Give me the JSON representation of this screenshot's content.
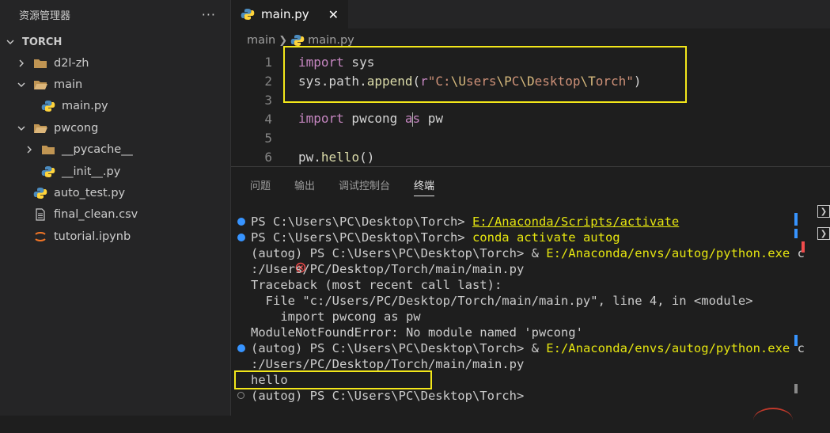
{
  "explorer": {
    "title": "资源管理器",
    "more": "···",
    "section": "TORCH",
    "items": [
      {
        "label": "d2l-zh",
        "type": "folder",
        "expanded": false,
        "depth": 1
      },
      {
        "label": "main",
        "type": "folder",
        "expanded": true,
        "depth": 1
      },
      {
        "label": "main.py",
        "type": "python",
        "depth": 2
      },
      {
        "label": "pwcong",
        "type": "folder",
        "expanded": true,
        "depth": 1
      },
      {
        "label": "__pycache__",
        "type": "folder",
        "expanded": false,
        "depth": 2
      },
      {
        "label": "__init__.py",
        "type": "python",
        "depth": 2
      },
      {
        "label": "auto_test.py",
        "type": "python",
        "depth": 1
      },
      {
        "label": "final_clean.csv",
        "type": "csv",
        "depth": 1
      },
      {
        "label": "tutorial.ipynb",
        "type": "notebook",
        "depth": 1
      }
    ]
  },
  "editor": {
    "tab_label": "main.py",
    "tab_close": "✕",
    "breadcrumb": [
      "main",
      "main.py"
    ],
    "lines": [
      {
        "n": "1",
        "text": "import sys"
      },
      {
        "n": "2",
        "text": "sys.path.append(r\"C:\\Users\\PC\\Desktop\\Torch\")"
      },
      {
        "n": "3",
        "text": ""
      },
      {
        "n": "4",
        "text": "import pwcong as pw"
      },
      {
        "n": "5",
        "text": ""
      },
      {
        "n": "6",
        "text": "pw.hello()"
      }
    ]
  },
  "panel": {
    "tabs": [
      "问题",
      "输出",
      "调试控制台",
      "终端"
    ],
    "active_tab": "终端"
  },
  "terminal": {
    "lines": [
      {
        "status": "blue",
        "prefix": "PS C:\\Users\\PC\\Desktop\\Torch> ",
        "cmd": "E:/Anaconda/Scripts/activate",
        "cmd_style": "underline"
      },
      {
        "status": "blue",
        "prefix": "PS C:\\Users\\PC\\Desktop\\Torch> ",
        "cmd": "conda activate autog",
        "cmd_style": "yellow"
      },
      {
        "status": "error",
        "prefix": "(autog) PS C:\\Users\\PC\\Desktop\\Torch> & ",
        "cmd": "E:/Anaconda/envs/autog/python.exe",
        "suffix": " c",
        "cmd_style": "yellow"
      },
      {
        "status": "",
        "prefix": ":/Users/PC/Desktop/Torch/main/main.py"
      },
      {
        "status": "",
        "prefix": "Traceback (most recent call last):"
      },
      {
        "status": "",
        "prefix": "  File \"c:/Users/PC/Desktop/Torch/main/main.py\", line 4, in <module>"
      },
      {
        "status": "",
        "prefix": "    import pwcong as pw"
      },
      {
        "status": "",
        "prefix": "ModuleNotFoundError: No module named 'pwcong'"
      },
      {
        "status": "blue",
        "prefix": "(autog) PS C:\\Users\\PC\\Desktop\\Torch> & ",
        "cmd": "E:/Anaconda/envs/autog/python.exe",
        "suffix": " c",
        "cmd_style": "yellow"
      },
      {
        "status": "",
        "prefix": ":/Users/PC/Desktop/Torch/main/main.py"
      },
      {
        "status": "",
        "prefix": "hello"
      },
      {
        "status": "hollow",
        "prefix": "(autog) PS C:\\Users\\PC\\Desktop\\Torch>"
      }
    ]
  },
  "colors": {
    "highlight_box": "#f3e71a",
    "keyword": "#c586c0",
    "string": "#ce9178",
    "terminal_command": "#e5e510",
    "status_blue": "#3794ff",
    "status_error": "#f14c4c"
  }
}
